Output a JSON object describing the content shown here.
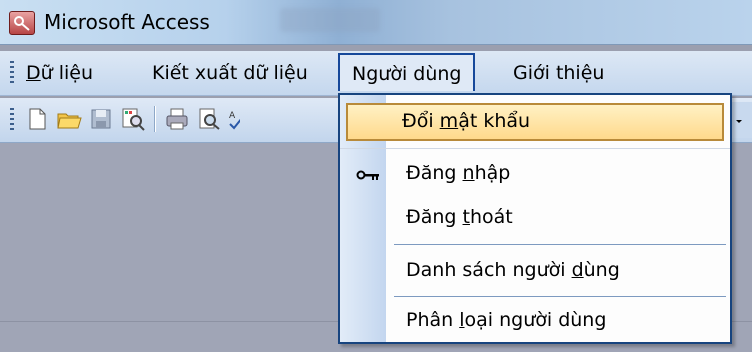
{
  "window": {
    "title": "Microsoft Access"
  },
  "menubar": {
    "items": [
      {
        "pre": "",
        "key": "D",
        "post": "ữ liệu"
      },
      {
        "pre": "Kiết xuất dữ liệu",
        "key": "",
        "post": ""
      },
      {
        "pre": "Người dùng",
        "key": "",
        "post": ""
      },
      {
        "pre": "Giới thiệu",
        "key": "",
        "post": ""
      }
    ]
  },
  "toolbar": {
    "icons": [
      "new-document-icon",
      "open-folder-icon",
      "save-icon",
      "file-search-icon",
      "print-icon",
      "print-preview-icon",
      "spelling-icon"
    ]
  },
  "dropdown": {
    "items": [
      {
        "pre": "Đổi ",
        "key": "m",
        "post": "ật khẩu",
        "icon": "",
        "highlighted": true
      },
      {
        "pre": "Đăng ",
        "key": "n",
        "post": "hập",
        "icon": "key-icon",
        "highlighted": false
      },
      {
        "pre": "Đăng ",
        "key": "t",
        "post": "hoát",
        "icon": "",
        "highlighted": false
      },
      {
        "pre": "Danh sách người ",
        "key": "d",
        "post": "ùng",
        "icon": "",
        "highlighted": false
      },
      {
        "pre": "Phân ",
        "key": "l",
        "post": "oại người dùng",
        "icon": "",
        "highlighted": false
      }
    ]
  },
  "colors": {
    "menu_active_border": "#16489a",
    "highlight_fill": "#ffd98c",
    "workspace": "#a0a5b6"
  }
}
